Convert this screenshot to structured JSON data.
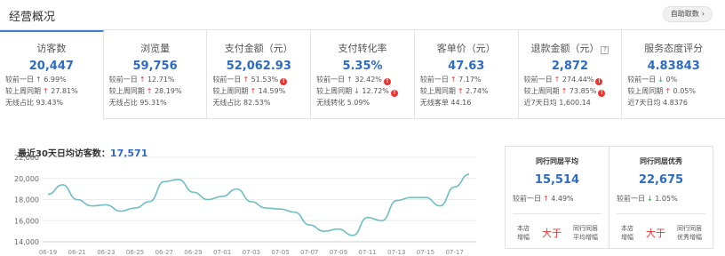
{
  "header": {
    "title": "经营概况",
    "auto_btn": "自助取数",
    "auto_chevron": "›"
  },
  "metrics": [
    {
      "name": "访客数",
      "value": "20,447",
      "rows": [
        {
          "label": "较前一日",
          "dir": "up",
          "val": "6.99%"
        },
        {
          "label": "较上周同期",
          "dir": "up",
          "val": "27.81%"
        },
        {
          "label": "无线占比",
          "dir": "",
          "val": "93.43%"
        }
      ]
    },
    {
      "name": "浏览量",
      "value": "59,756",
      "rows": [
        {
          "label": "较前一日",
          "dir": "up",
          "val": "12.71%"
        },
        {
          "label": "较上周同期",
          "dir": "up",
          "val": "28.19%"
        },
        {
          "label": "无线占比",
          "dir": "",
          "val": "95.31%"
        }
      ]
    },
    {
      "name": "支付金额（元）",
      "value": "52,062.93",
      "rows": [
        {
          "label": "较前一日",
          "dir": "up",
          "val": "51.53%",
          "warn": true
        },
        {
          "label": "较上周同期",
          "dir": "up",
          "val": "14.59%"
        },
        {
          "label": "无线占比",
          "dir": "",
          "val": "82.53%"
        }
      ]
    },
    {
      "name": "支付转化率",
      "value": "5.35%",
      "rows": [
        {
          "label": "较前一日",
          "dir": "up",
          "val": "32.42%",
          "warn": true
        },
        {
          "label": "较上周同期",
          "dir": "down",
          "val": "12.72%",
          "warn": true
        },
        {
          "label": "无线转化",
          "dir": "",
          "val": "5.09%"
        }
      ]
    },
    {
      "name": "客单价（元）",
      "value": "47.63",
      "rows": [
        {
          "label": "较前一日",
          "dir": "up",
          "val": "7.17%"
        },
        {
          "label": "较上周同期",
          "dir": "up",
          "val": "2.74%"
        },
        {
          "label": "无线客单",
          "dir": "",
          "val": "44.16"
        }
      ]
    },
    {
      "name": "退款金额（元）",
      "value": "2,872",
      "qmark": "?",
      "rows": [
        {
          "label": "较前一日",
          "dir": "up",
          "val": "274.44%",
          "warn": true
        },
        {
          "label": "较上周同期",
          "dir": "up",
          "val": "73.85%",
          "warn": true
        },
        {
          "label": "近7天日均",
          "dir": "",
          "val": "1,600.14"
        }
      ]
    },
    {
      "name": "服务态度评分",
      "value": "4.83843",
      "rows": [
        {
          "label": "较前一日",
          "dir": "down",
          "val": "0%"
        },
        {
          "label": "较上周同期",
          "dir": "up",
          "val": "0.05%"
        },
        {
          "label": "近7天日均",
          "dir": "",
          "val": "4.8376"
        }
      ]
    }
  ],
  "warn_glyph": "!",
  "arrows": {
    "up": "↑",
    "down": "↓"
  },
  "chart_header": {
    "label": "最近30天日均访客数：",
    "value": "17,571"
  },
  "chart_data": {
    "type": "line",
    "ylim": [
      14000,
      22000
    ],
    "yticks": [
      "22,000",
      "20,000",
      "18,000",
      "16,000",
      "14,000"
    ],
    "xtick_labels": [
      "06-19",
      "06-21",
      "06-23",
      "06-25",
      "06-27",
      "06-29",
      "07-01",
      "07-03",
      "07-05",
      "07-07",
      "07-09",
      "07-11",
      "07-13",
      "07-15",
      "07-17"
    ],
    "x": [
      "06-19",
      "06-20",
      "06-21",
      "06-22",
      "06-23",
      "06-24",
      "06-25",
      "06-26",
      "06-27",
      "06-28",
      "06-29",
      "06-30",
      "07-01",
      "07-02",
      "07-03",
      "07-04",
      "07-05",
      "07-06",
      "07-07",
      "07-08",
      "07-09",
      "07-10",
      "07-11",
      "07-12",
      "07-13",
      "07-14",
      "07-15",
      "07-16",
      "07-17",
      "07-18"
    ],
    "series": [
      {
        "values": [
          18500,
          19400,
          18000,
          17400,
          17500,
          16900,
          17200,
          17800,
          19700,
          19900,
          18700,
          18000,
          18300,
          19000,
          17800,
          17200,
          17100,
          16800,
          15600,
          15000,
          15200,
          14600,
          16300,
          16000,
          17900,
          18200,
          18200,
          17400,
          19200,
          20400
        ]
      }
    ],
    "color": "#6cbfc0",
    "grid": true
  },
  "peers": [
    {
      "title": "同行同层平均",
      "value": "15,514",
      "cmp_label": "较前一日",
      "dir": "up",
      "cmp_val": "4.49%",
      "foot_left": [
        "本店",
        "增幅"
      ],
      "foot_mid": "大于",
      "foot_right": [
        "同行同层",
        "平均增幅"
      ]
    },
    {
      "title": "同行同层优秀",
      "value": "22,675",
      "cmp_label": "较前一日",
      "dir": "down",
      "cmp_val": "1.05%",
      "foot_left": [
        "本店",
        "增幅"
      ],
      "foot_mid": "大于",
      "foot_right": [
        "同行同层",
        "优秀增幅"
      ]
    }
  ]
}
